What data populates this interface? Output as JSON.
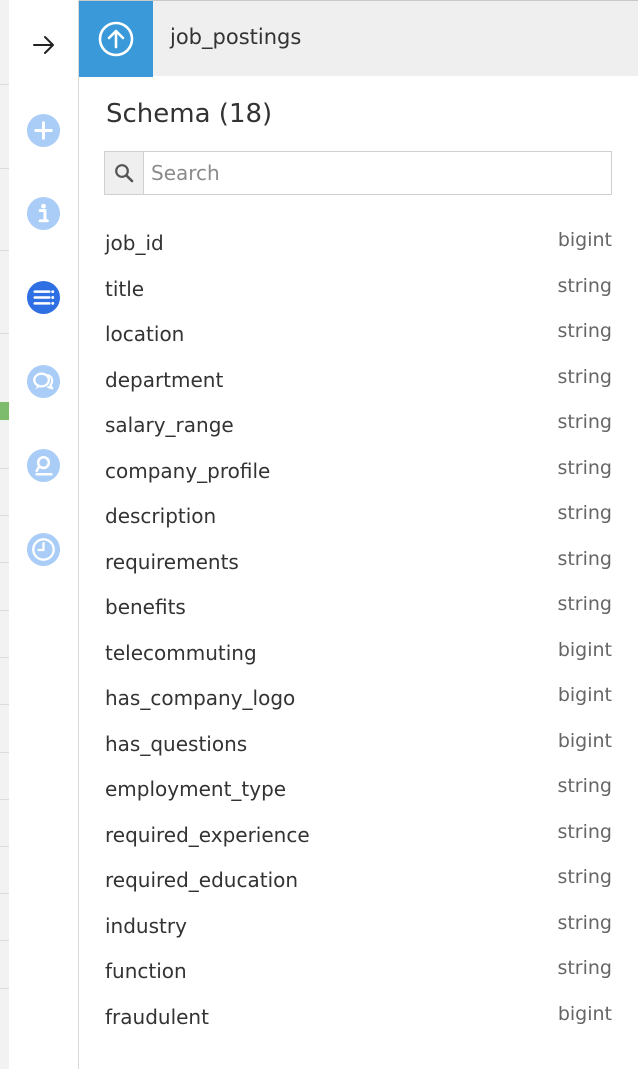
{
  "header": {
    "title": "job_postings",
    "icon": "upload-circle-icon",
    "accent": "#3a9ad9"
  },
  "rail": {
    "collapse_icon": "arrow-right-icon",
    "items": [
      {
        "icon": "plus-circle-icon",
        "active": false
      },
      {
        "icon": "info-circle-icon",
        "active": false
      },
      {
        "icon": "schema-list-icon",
        "active": true
      },
      {
        "icon": "chat-bubbles-icon",
        "active": false
      },
      {
        "icon": "lab-flask-icon",
        "active": false
      },
      {
        "icon": "clock-history-icon",
        "active": false
      }
    ],
    "active_color": "#2f6fe4",
    "inactive_color": "#a9cdf6"
  },
  "schema": {
    "title": "Schema (18)",
    "search_placeholder": "Search",
    "search_value": "",
    "fields": [
      {
        "name": "job_id",
        "type": "bigint"
      },
      {
        "name": "title",
        "type": "string"
      },
      {
        "name": "location",
        "type": "string"
      },
      {
        "name": "department",
        "type": "string"
      },
      {
        "name": "salary_range",
        "type": "string"
      },
      {
        "name": "company_profile",
        "type": "string"
      },
      {
        "name": "description",
        "type": "string"
      },
      {
        "name": "requirements",
        "type": "string"
      },
      {
        "name": "benefits",
        "type": "string"
      },
      {
        "name": "telecommuting",
        "type": "bigint"
      },
      {
        "name": "has_company_logo",
        "type": "bigint"
      },
      {
        "name": "has_questions",
        "type": "bigint"
      },
      {
        "name": "employment_type",
        "type": "string"
      },
      {
        "name": "required_experience",
        "type": "string"
      },
      {
        "name": "required_education",
        "type": "string"
      },
      {
        "name": "industry",
        "type": "string"
      },
      {
        "name": "function",
        "type": "string"
      },
      {
        "name": "fraudulent",
        "type": "bigint"
      }
    ]
  }
}
